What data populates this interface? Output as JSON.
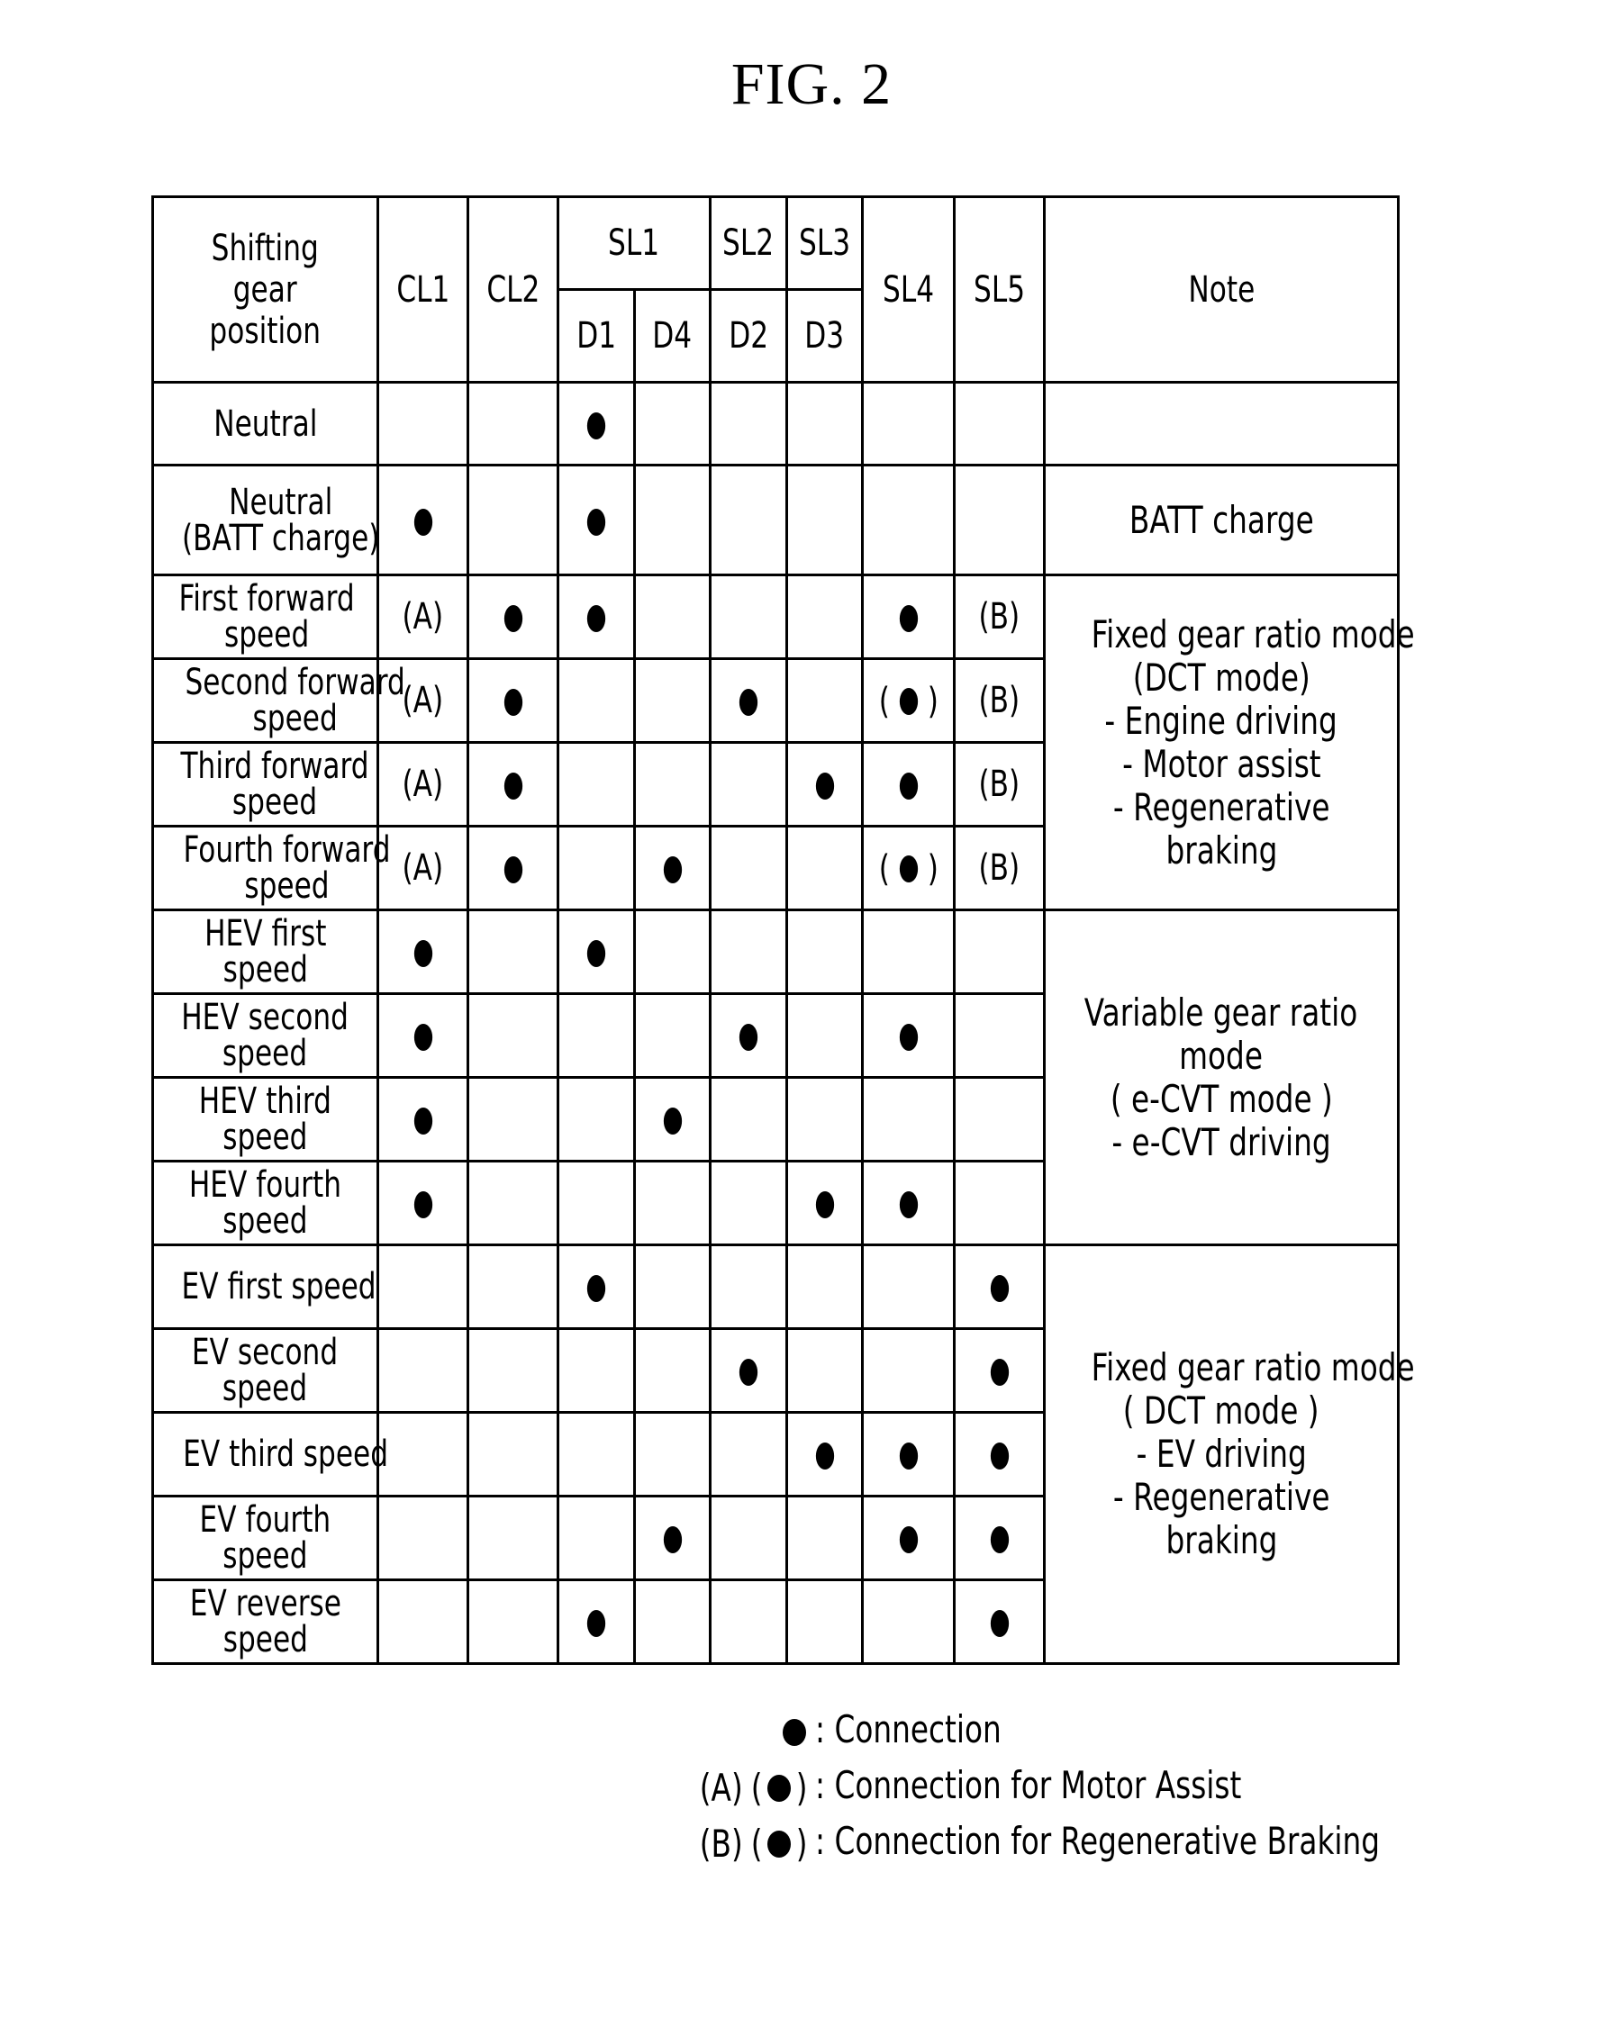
{
  "figure": {
    "title": "FIG. 2"
  },
  "table": {
    "header": {
      "row_label": "Shifting gear position",
      "row_label_lines": [
        "Shifting",
        "gear",
        "position"
      ],
      "cl1": "CL1",
      "cl2": "CL2",
      "sl1": "SL1",
      "sl2": "SL2",
      "sl3": "SL3",
      "sl4": "SL4",
      "sl5": "SL5",
      "d1": "D1",
      "d4": "D4",
      "d2": "D2",
      "d3": "D3",
      "note": "Note"
    },
    "columns": [
      "CL1",
      "CL2",
      "D1",
      "D4",
      "D2",
      "D3",
      "SL4",
      "SL5"
    ],
    "rows": [
      {
        "label_lines": [
          "Neutral"
        ],
        "cells": [
          "",
          "",
          "●",
          "",
          "",
          "",
          "",
          ""
        ]
      },
      {
        "label_lines": [
          "Neutral",
          "(BATT charge)"
        ],
        "cells": [
          "●",
          "",
          "●",
          "",
          "",
          "",
          "",
          ""
        ]
      },
      {
        "label_lines": [
          "First forward",
          "speed"
        ],
        "cells": [
          "(A)",
          "●",
          "●",
          "",
          "",
          "",
          "●",
          "(B)"
        ]
      },
      {
        "label_lines": [
          "Second forward",
          "speed"
        ],
        "cells": [
          "(A)",
          "●",
          "",
          "",
          "●",
          "",
          "(●)",
          "(B)"
        ]
      },
      {
        "label_lines": [
          "Third forward",
          "speed"
        ],
        "cells": [
          "(A)",
          "●",
          "",
          "",
          "",
          "●",
          "●",
          "(B)"
        ]
      },
      {
        "label_lines": [
          "Fourth forward",
          "speed"
        ],
        "cells": [
          "(A)",
          "●",
          "",
          "●",
          "",
          "",
          "(●)",
          "(B)"
        ]
      },
      {
        "label_lines": [
          "HEV first",
          "speed"
        ],
        "cells": [
          "●",
          "",
          "●",
          "",
          "",
          "",
          "",
          ""
        ]
      },
      {
        "label_lines": [
          "HEV second",
          "speed"
        ],
        "cells": [
          "●",
          "",
          "",
          "",
          "●",
          "",
          "●",
          ""
        ]
      },
      {
        "label_lines": [
          "HEV third",
          "speed"
        ],
        "cells": [
          "●",
          "",
          "",
          "●",
          "",
          "",
          "",
          ""
        ]
      },
      {
        "label_lines": [
          "HEV fourth",
          "speed"
        ],
        "cells": [
          "●",
          "",
          "",
          "",
          "",
          "●",
          "●",
          ""
        ]
      },
      {
        "label_lines": [
          "EV first speed"
        ],
        "cells": [
          "",
          "",
          "●",
          "",
          "",
          "",
          "",
          "●"
        ]
      },
      {
        "label_lines": [
          "EV second",
          "speed"
        ],
        "cells": [
          "",
          "",
          "",
          "",
          "●",
          "",
          "",
          "●"
        ]
      },
      {
        "label_lines": [
          "EV third speed"
        ],
        "cells": [
          "",
          "",
          "",
          "",
          "",
          "●",
          "●",
          "●"
        ]
      },
      {
        "label_lines": [
          "EV fourth",
          "speed"
        ],
        "cells": [
          "",
          "",
          "",
          "●",
          "",
          "",
          "●",
          "●"
        ]
      },
      {
        "label_lines": [
          "EV reverse",
          "speed"
        ],
        "cells": [
          "",
          "",
          "●",
          "",
          "",
          "",
          "",
          "●"
        ]
      }
    ],
    "notes": [
      {
        "rows": "Neutral",
        "lines": []
      },
      {
        "rows": "Neutral (BATT charge)",
        "lines": [
          "BATT charge"
        ]
      },
      {
        "rows": "First-Fourth forward speed",
        "lines": [
          "Fixed gear ratio mode",
          "(DCT mode)",
          "- Engine driving",
          "- Motor assist",
          "- Regenerative",
          "braking"
        ]
      },
      {
        "rows": "HEV first-fourth speed",
        "lines": [
          "Variable gear ratio",
          "mode",
          "( e-CVT mode )",
          "- e-CVT driving"
        ]
      },
      {
        "rows": "EV first-reverse speed",
        "lines": [
          "Fixed gear ratio mode",
          "( DCT mode )",
          "- EV driving",
          "- Regenerative",
          "braking"
        ]
      }
    ]
  },
  "legend": [
    {
      "symbol": "●",
      "separator": ":",
      "text": "Connection"
    },
    {
      "symbol": "(A)(●)",
      "separator": ":",
      "text": "Connection for Motor Assist"
    },
    {
      "symbol": "(B)(●)",
      "separator": ":",
      "text": "Connection for Regenerative Braking"
    }
  ]
}
